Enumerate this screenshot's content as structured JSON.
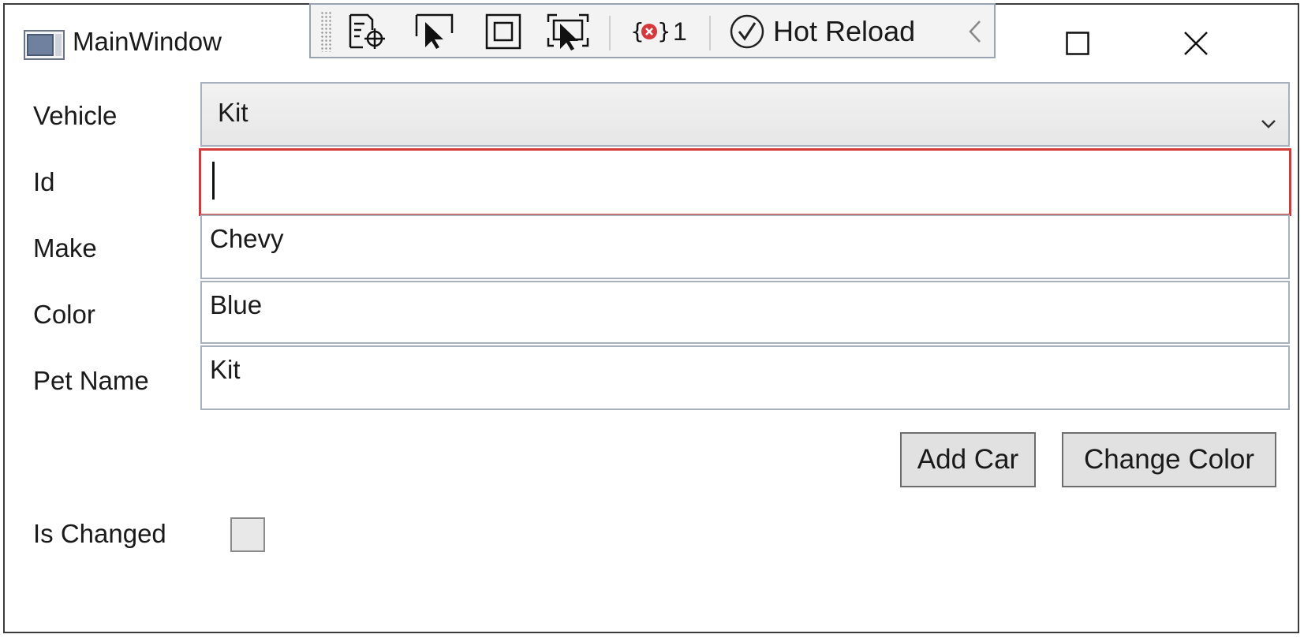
{
  "window": {
    "title": "MainWindow"
  },
  "debug_toolbar": {
    "error_count": "1",
    "hot_reload_label": "Hot Reload",
    "icons": [
      "live-visual-tree-icon",
      "select-element-icon",
      "display-adorners-icon",
      "track-focus-icon",
      "error-icon",
      "hot-reload-check-icon",
      "chevron-left-icon"
    ]
  },
  "form": {
    "vehicle": {
      "label": "Vehicle",
      "value": "Kit"
    },
    "id": {
      "label": "Id",
      "value": ""
    },
    "make": {
      "label": "Make",
      "value": "Chevy"
    },
    "color": {
      "label": "Color",
      "value": "Blue"
    },
    "pet_name": {
      "label": "Pet Name",
      "value": "Kit"
    },
    "is_changed": {
      "label": "Is Changed",
      "checked": false
    }
  },
  "buttons": {
    "add_car": "Add Car",
    "change_color": "Change Color"
  },
  "colors": {
    "focus_border": "#d6393b",
    "field_border": "#a9b0bd",
    "button_bg": "#e1e1e1"
  }
}
